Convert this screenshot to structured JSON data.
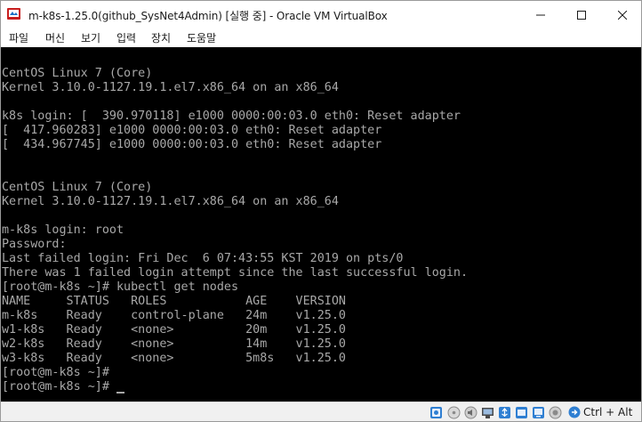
{
  "window": {
    "title": "m-k8s-1.25.0(github_SysNet4Admin) [실행 중] - Oracle VM VirtualBox"
  },
  "menu": {
    "items": [
      "파일",
      "머신",
      "보기",
      "입력",
      "장치",
      "도움말"
    ]
  },
  "console": {
    "lines": [
      "",
      "CentOS Linux 7 (Core)",
      "Kernel 3.10.0-1127.19.1.el7.x86_64 on an x86_64",
      "",
      "k8s login: [  390.970118] e1000 0000:00:03.0 eth0: Reset adapter",
      "[  417.960283] e1000 0000:00:03.0 eth0: Reset adapter",
      "[  434.967745] e1000 0000:00:03.0 eth0: Reset adapter",
      "",
      "",
      "CentOS Linux 7 (Core)",
      "Kernel 3.10.0-1127.19.1.el7.x86_64 on an x86_64",
      "",
      "m-k8s login: root",
      "Password:",
      "Last failed login: Fri Dec  6 07:43:55 KST 2019 on pts/0",
      "There was 1 failed login attempt since the last successful login.",
      "[root@m-k8s ~]# kubectl get nodes",
      "NAME     STATUS   ROLES           AGE    VERSION",
      "m-k8s    Ready    control-plane   24m    v1.25.0",
      "w1-k8s   Ready    <none>          20m    v1.25.0",
      "w2-k8s   Ready    <none>          14m    v1.25.0",
      "w3-k8s   Ready    <none>          5m8s   v1.25.0",
      "[root@m-k8s ~]#",
      "[root@m-k8s ~]# "
    ],
    "text_color": "#a8a8a8",
    "background": "#000000"
  },
  "statusbar": {
    "host_key": "Ctrl + Alt",
    "icons": [
      "hard-disk-icon",
      "optical-drive-icon",
      "audio-icon",
      "network-icon",
      "usb-icon",
      "shared-folders-icon",
      "display-icon",
      "recording-icon",
      "cpu-icon",
      "mouse-integration-icon"
    ]
  },
  "colors": {
    "vbox_blue": "#1a6fc4",
    "close_hover": "#c42b1c"
  }
}
